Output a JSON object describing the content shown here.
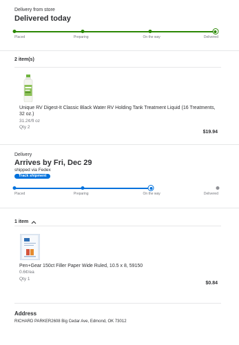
{
  "order1": {
    "delivery_from": "Delivery from store",
    "status_title": "Delivered today",
    "tracker_color": "#2a8703",
    "steps": [
      "Placed",
      "Preparing",
      "On the way",
      "Delivered"
    ],
    "items_count": "2 item(s)",
    "item": {
      "name": "Unique RV Digest-It Classic Black Water RV Holding Tank Treatment Liquid (16 Treatments, 32 oz.)",
      "unit_price": "31.2¢/fl oz",
      "qty": "Qty 2",
      "price": "$19.94",
      "icon": "bottle-product-image"
    }
  },
  "order2": {
    "label": "Delivery",
    "status_title": "Arrives by Fri, Dec 29",
    "shipped_via": "shipped via Fedex",
    "track_button": "Track shipment",
    "tracker_color": "#0071dc",
    "steps": [
      "Placed",
      "Preparing",
      "On the way",
      "Delivered"
    ],
    "items_count": "1 item",
    "item": {
      "name": "Pen+Gear 150ct Filler Paper Wide Ruled, 10.5 x 8, 59150",
      "unit_price": "0.6¢/ea",
      "qty": "Qty 1",
      "price": "$0.84",
      "icon": "paper-pack-product-image"
    }
  },
  "address": {
    "heading": "Address",
    "text": "RICHARD PARKER2608 Big Cedar Ave, Edmond, OK 73012"
  }
}
